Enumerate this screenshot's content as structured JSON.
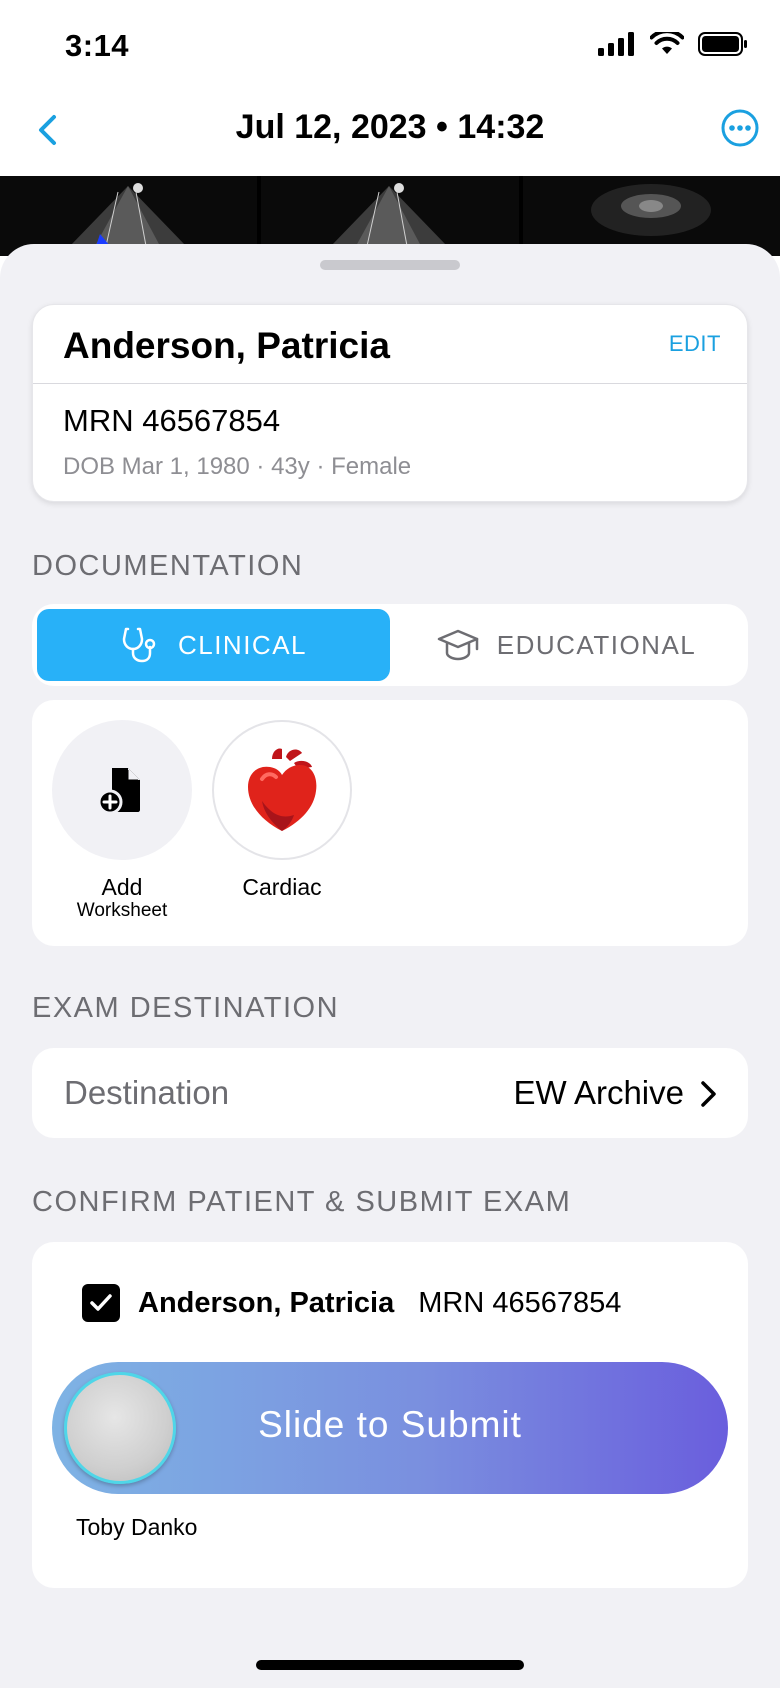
{
  "status": {
    "time": "3:14"
  },
  "nav": {
    "title": "Jul 12, 2023  •  14:32"
  },
  "patient": {
    "name": "Anderson, Patricia",
    "edit": "EDIT",
    "mrn": "MRN 46567854",
    "demographics": "DOB Mar 1, 1980  ·  43y  ·  Female"
  },
  "documentation": {
    "section_title": "DOCUMENTATION",
    "tabs": [
      {
        "label": "CLINICAL",
        "selected": true
      },
      {
        "label": "EDUCATIONAL",
        "selected": false
      }
    ],
    "worksheets": [
      {
        "label": "Add",
        "sublabel": "Worksheet"
      },
      {
        "label": "Cardiac"
      }
    ]
  },
  "destination": {
    "section_title": "EXAM DESTINATION",
    "label": "Destination",
    "value": "EW Archive"
  },
  "submit": {
    "section_title": "CONFIRM PATIENT & SUBMIT EXAM",
    "confirm_name": "Anderson, Patricia",
    "confirm_mrn": "MRN 46567854",
    "confirmed": true,
    "slider_label": "Slide to Submit",
    "user": "Toby Danko"
  },
  "colors": {
    "accent": "#28b1f8",
    "link": "#1aa0e0",
    "heart": "#e0231b"
  }
}
